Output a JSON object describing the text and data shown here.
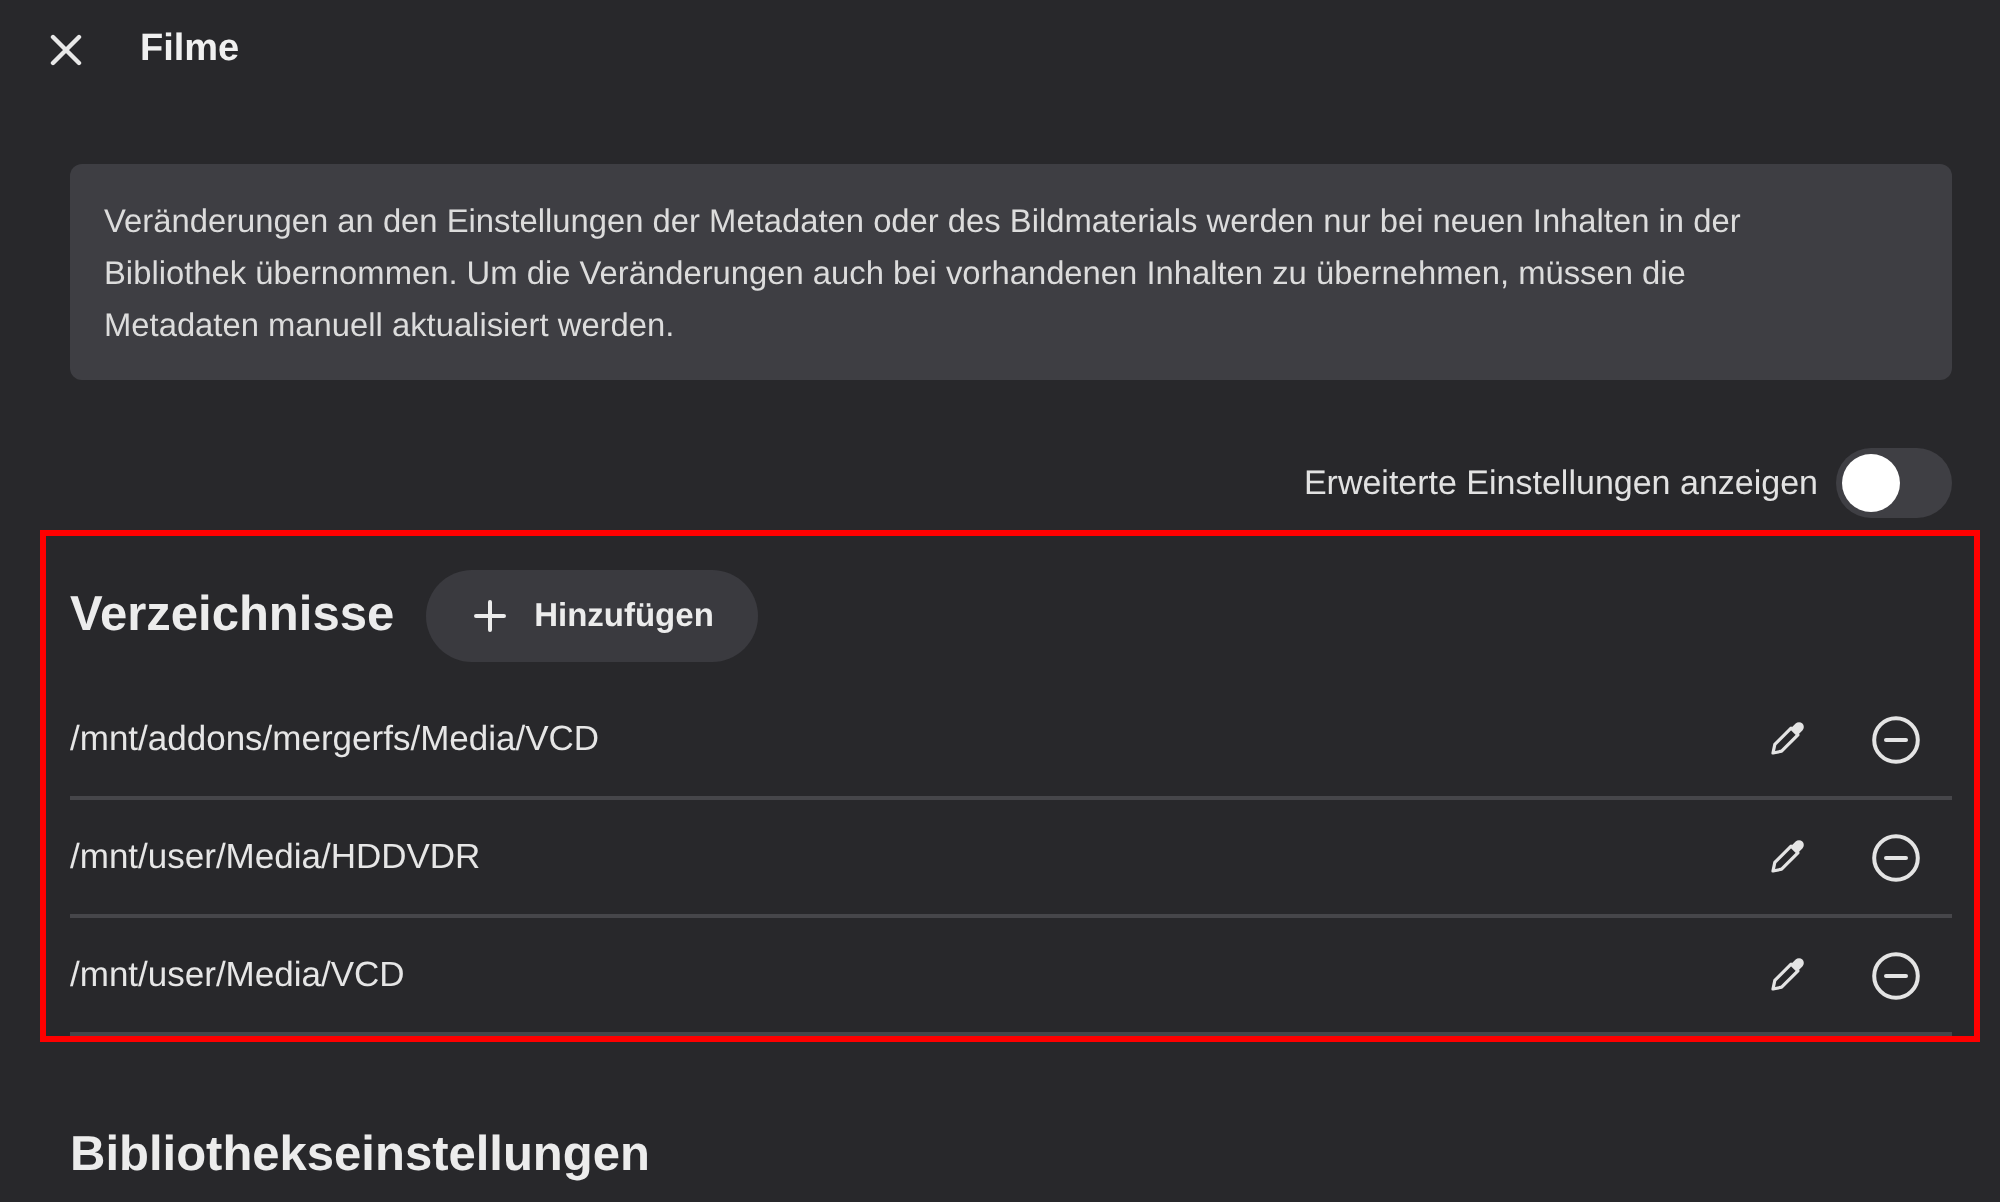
{
  "header": {
    "title": "Filme"
  },
  "notice": {
    "text": "Veränderungen an den Einstellungen der Metadaten oder des Bildmaterials werden nur bei neuen Inhalten in der Bibliothek übernommen. Um die Veränderungen auch bei vorhandenen Inhalten zu übernehmen, müssen die Metadaten manuell aktualisiert werden."
  },
  "advanced_toggle": {
    "label": "Erweiterte Einstellungen anzeigen",
    "on": false
  },
  "directories": {
    "title": "Verzeichnisse",
    "highlighted": true,
    "add_button": {
      "label": "Hinzufügen"
    },
    "items": [
      {
        "path": "/mnt/addons/mergerfs/Media/VCD"
      },
      {
        "path": "/mnt/user/Media/HDDVDR"
      },
      {
        "path": "/mnt/user/Media/VCD"
      }
    ]
  },
  "library_settings": {
    "title": "Bibliothekseinstellungen"
  }
}
